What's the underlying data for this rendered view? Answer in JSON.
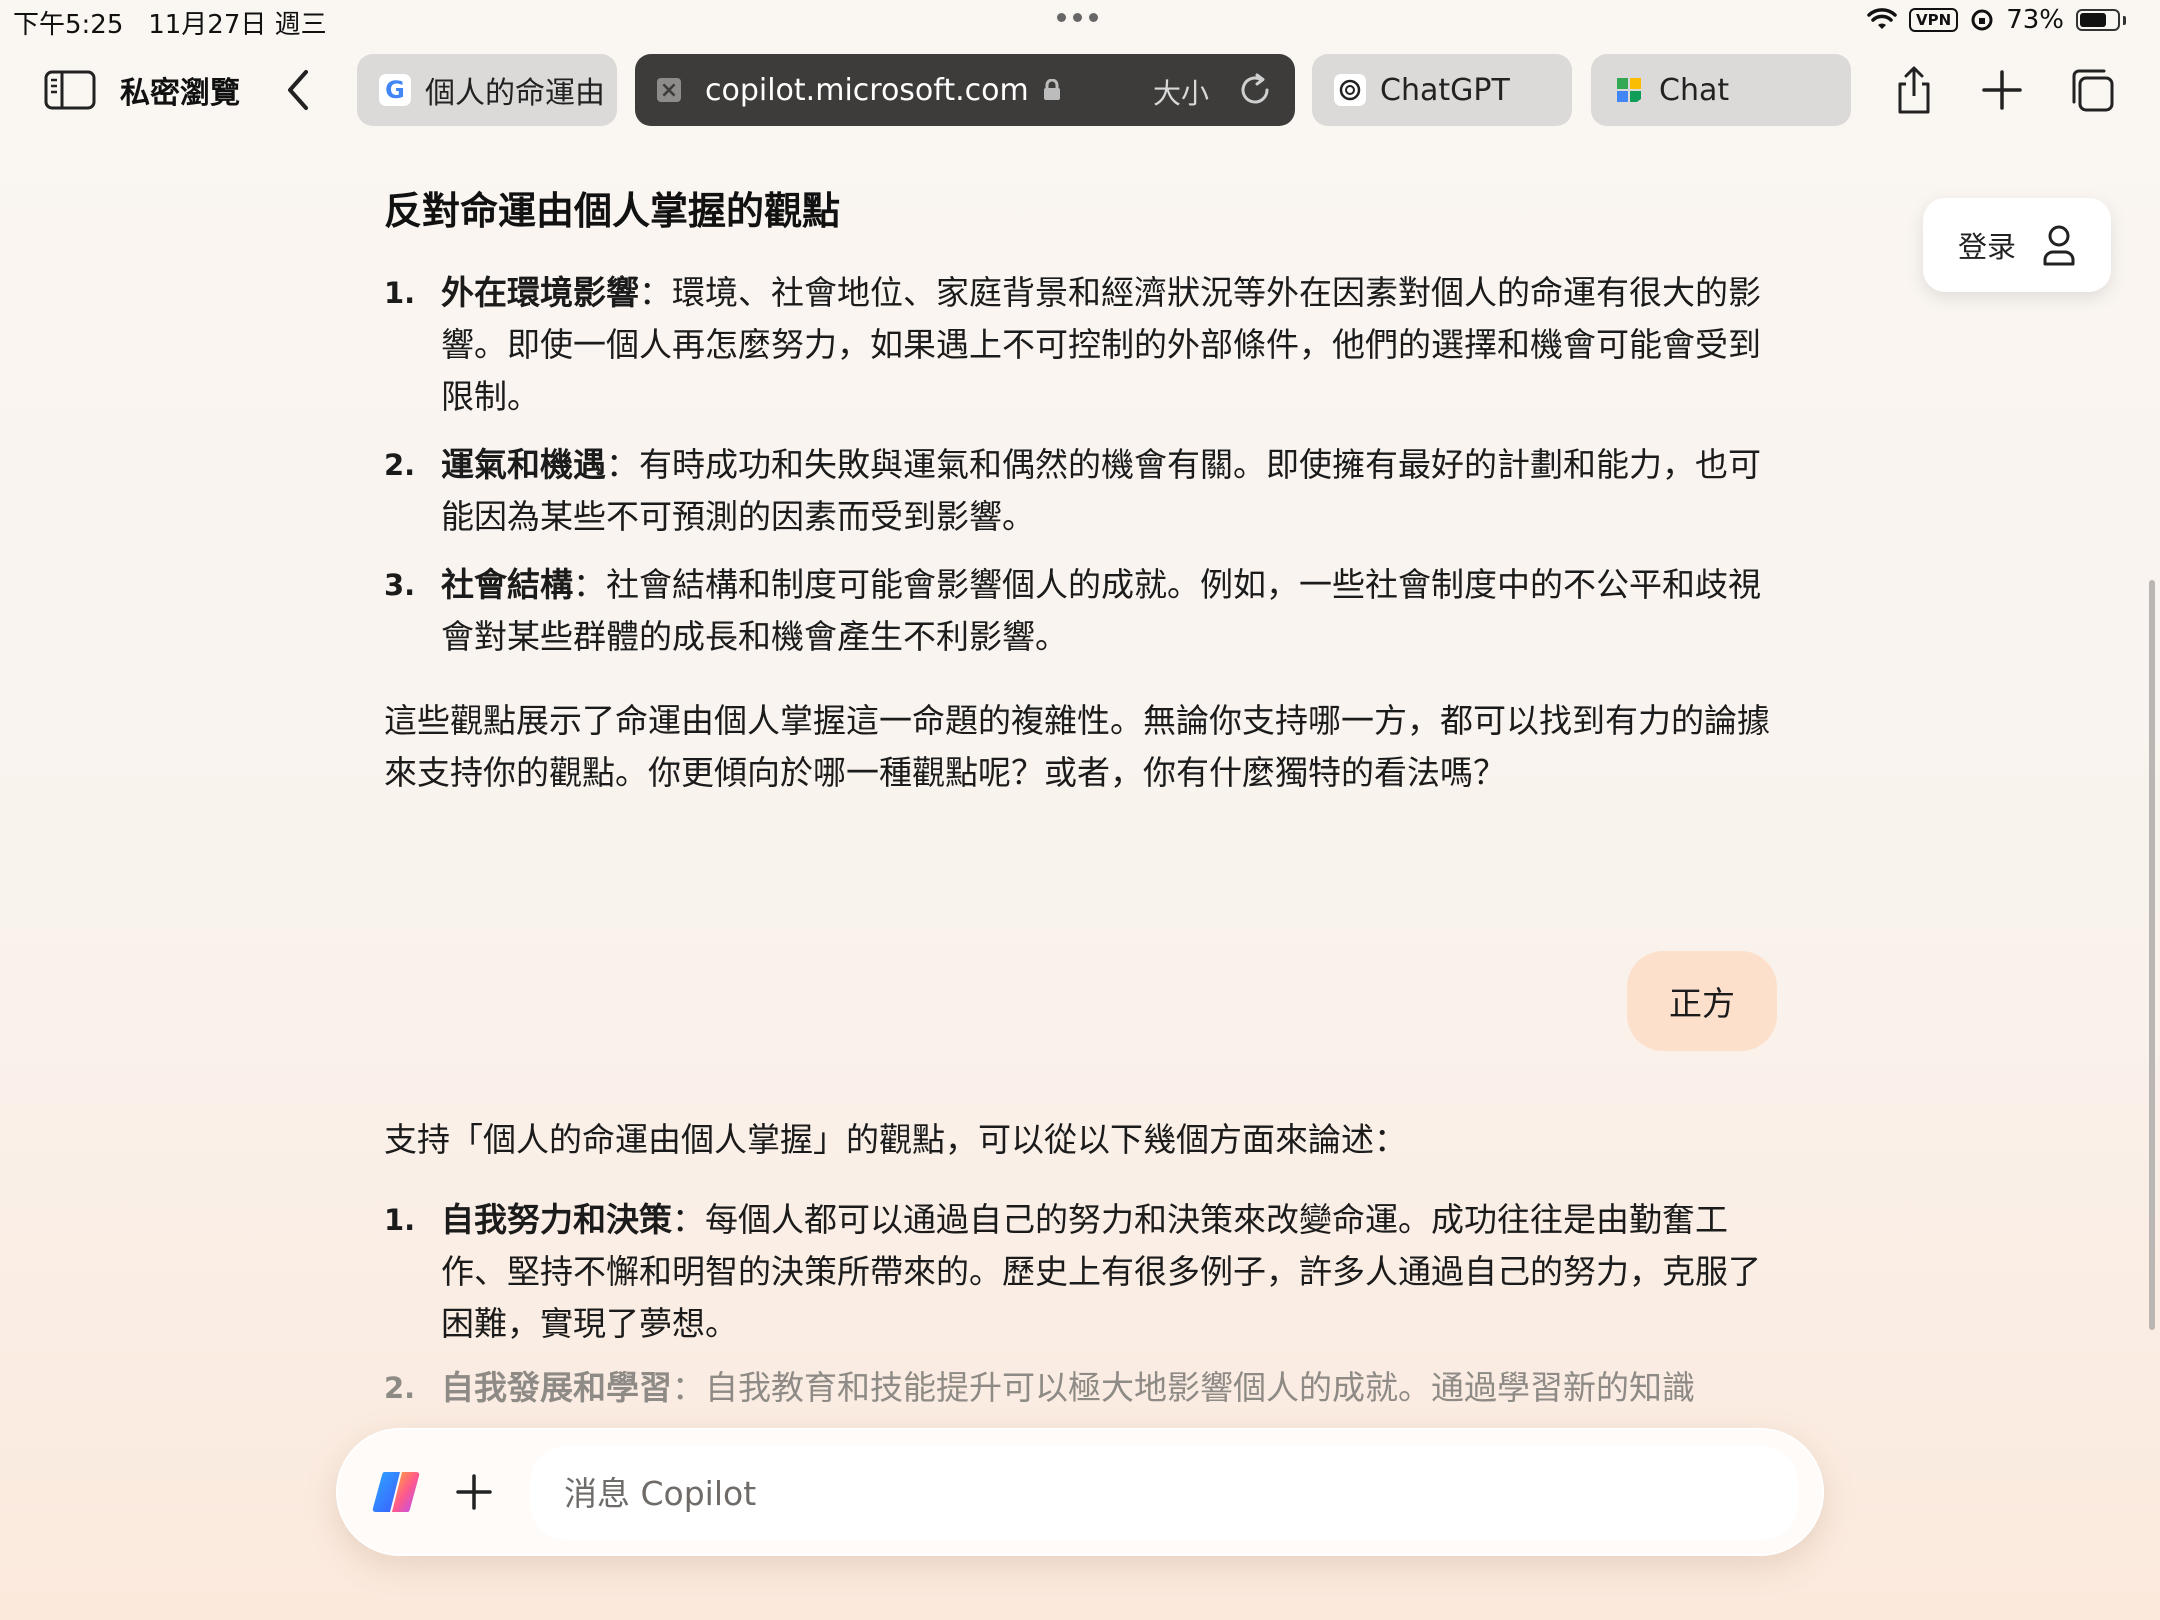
{
  "status": {
    "time": "下午5:25",
    "date": "11月27日 週三",
    "vpn": "VPN",
    "battery": "73%",
    "battery_level": 0.73
  },
  "toolbar": {
    "private_label": "私密瀏覽",
    "tabs": [
      {
        "title": "個人的命運由",
        "icon": "google-icon"
      },
      {
        "url": "copilot.microsoft.com",
        "icon": "close-icon",
        "text_size": "大小"
      },
      {
        "title": "ChatGPT",
        "icon": "chatgpt-icon"
      },
      {
        "title": "Chat",
        "icon": "chat-icon"
      }
    ]
  },
  "login": {
    "label": "登录"
  },
  "section": {
    "heading": "反對命運由個人掌握的觀點",
    "items": [
      {
        "num": "1.",
        "term": "外在環境影響",
        "colon": "：",
        "text": "環境、社會地位、家庭背景和經濟狀況等外在因素對個人的命運有很大的影響。即使一個人再怎麼努力，如果遇上不可控制的外部條件，他們的選擇和機會可能會受到限制。"
      },
      {
        "num": "2.",
        "term": "運氣和機遇",
        "colon": "：",
        "text": "有時成功和失敗與運氣和偶然的機會有關。即使擁有最好的計劃和能力，也可能因為某些不可預測的因素而受到影響。"
      },
      {
        "num": "3.",
        "term": "社會結構",
        "colon": "：",
        "text": "社會結構和制度可能會影響個人的成就。例如，一些社會制度中的不公平和歧視會對某些群體的成長和機會產生不利影響。"
      }
    ],
    "summary": "這些觀點展示了命運由個人掌握這一命題的複雜性。無論你支持哪一方，都可以找到有力的論據來支持你的觀點。你更傾向於哪一種觀點呢？或者，你有什麼獨特的看法嗎？"
  },
  "user_message": "正方",
  "answer": {
    "intro": "支持「個人的命運由個人掌握」的觀點，可以從以下幾個方面來論述：",
    "items": [
      {
        "num": "1.",
        "term": "自我努力和決策",
        "colon": "：",
        "text": "每個人都可以通過自己的努力和決策來改變命運。成功往往是由勤奮工作、堅持不懈和明智的決策所帶來的。歷史上有很多例子，許多人通過自己的努力，克服了困難，實現了夢想。"
      },
      {
        "num": "2.",
        "term": "自我發展和學習",
        "colon": "：",
        "text": "自我教育和技能提升可以極大地影響個人的成就。通過學習新的知識"
      }
    ]
  },
  "composer": {
    "placeholder": "消息 Copilot"
  }
}
